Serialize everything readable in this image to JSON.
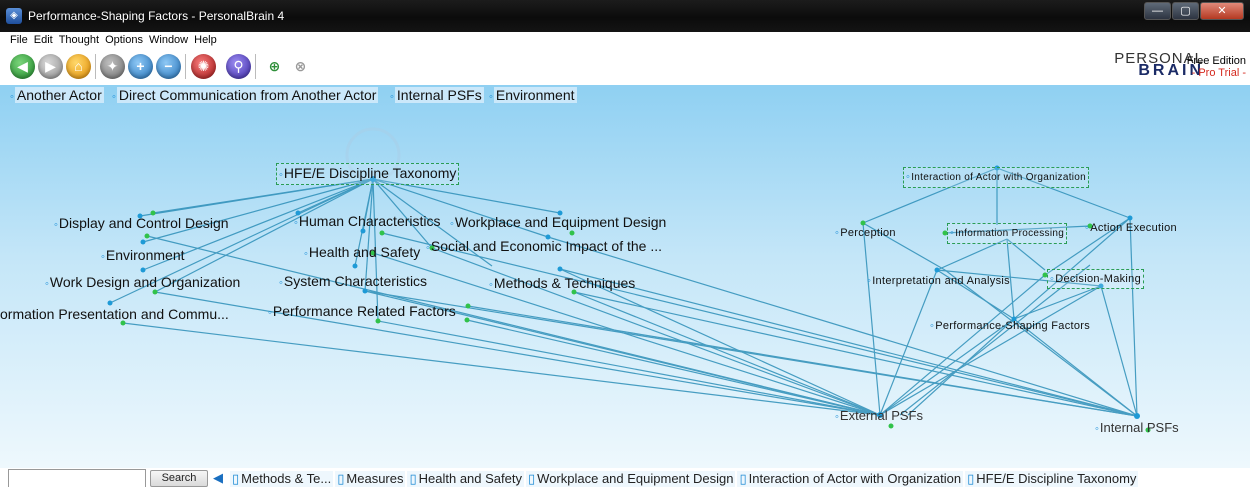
{
  "window": {
    "title": "Performance-Shaping Factors - PersonalBrain 4",
    "min": "—",
    "max": "▢",
    "close": "✕"
  },
  "menu": [
    "File",
    "Edit",
    "Thought",
    "Options",
    "Window",
    "Help"
  ],
  "toolbar": {
    "icons": [
      "back-icon",
      "forward-icon",
      "home-icon",
      "share-icon",
      "zoom-in-icon",
      "zoom-out-icon",
      "brain-icon",
      "search-icon",
      "link-add-icon",
      "link-remove-icon"
    ]
  },
  "brand": {
    "line1": "PERSONAL",
    "line2": "BRAIN",
    "edition": "Free Edition",
    "trial": "- Pro Trial -"
  },
  "jumps": [
    "Another Actor",
    "Direct Communication from Another Actor",
    "Internal PSFs",
    "Environment"
  ],
  "plex": {
    "active": "HFE/E Discipline Taxonomy",
    "left_nodes": {
      "display": "Display and Control Design",
      "human": "Human Characteristics",
      "workplace": "Workplace and Equipment Design",
      "health": "Health and Safety",
      "environment": "Environment",
      "social": "Social and Economic Impact of the ...",
      "work_design": "Work Design and Organization",
      "system": "System Characteristics",
      "methods": "Methods & Techniques",
      "info_pres": "ormation Presentation and Commu...",
      "performance": "Performance Related Factors"
    },
    "right_nodes": {
      "interaction": "Interaction of Actor with Organization",
      "perception": "Perception",
      "info_proc": "Information Processing",
      "action": "Action Execution",
      "interp": "Interpretation and Analysis",
      "decision": "Decision-Making",
      "psf": "Performance-Shaping Factors",
      "external": "External PSFs",
      "internal": "Internal PSFs"
    }
  },
  "bottom": {
    "search_button": "Search",
    "history": [
      "Methods & Te...",
      "Measures",
      "Health and Safety",
      "Workplace and Equipment Design",
      "Interaction of Actor with Organization",
      "HFE/E Discipline Taxonomy"
    ]
  }
}
